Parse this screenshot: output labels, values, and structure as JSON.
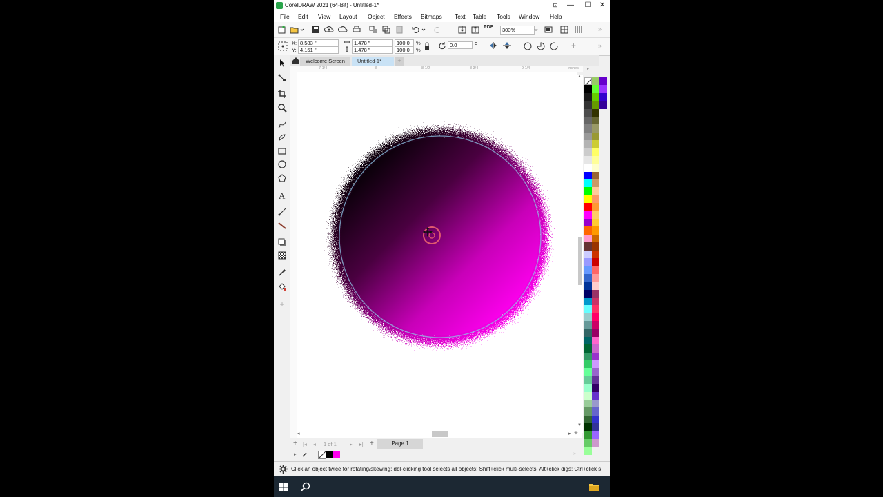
{
  "window": {
    "title": "CorelDRAW 2021 (64-Bit) - Untitled-1*"
  },
  "menu": [
    "File",
    "Edit",
    "View",
    "Layout",
    "Object",
    "Effects",
    "Bitmaps",
    "Text",
    "Table",
    "Tools",
    "Window",
    "Help"
  ],
  "toolbar": {
    "zoom": "303%",
    "pdf_label": "PDF"
  },
  "properties": {
    "x": "8.583 \"",
    "y": "4.151 \"",
    "width": "1.478 \"",
    "height": "1.478 \"",
    "scale_w": "100.0",
    "scale_h": "100.0",
    "percent": "%",
    "angle": "0.0",
    "x_label": "X:",
    "y_label": "Y:",
    "degree": "o"
  },
  "tabs": {
    "welcome": "Welcome Screen",
    "doc": "Untitled-1*"
  },
  "ruler": {
    "units": "inches",
    "ticks": [
      "7 1/4",
      "8",
      "8 1/2",
      "8 3/4",
      "9 1/4"
    ]
  },
  "page_nav": {
    "counter": "1 of 1",
    "page_tab": "Page 1"
  },
  "status": {
    "hint": "Click an object twice for rotating/skewing; dbl-clicking tool selects all objects; Shift+click multi-selects; Alt+click digs; Ctrl+click s"
  },
  "colors": {
    "accent": "#ff00ee",
    "dark": "#1a0014",
    "selection": "#c8e4f4"
  },
  "palette_col1": [
    "#000000",
    "#1a1a1a",
    "#333333",
    "#4d4d4d",
    "#666666",
    "#808080",
    "#999999",
    "#b3b3b3",
    "#cccccc",
    "#e6e6e6",
    "#ffffff",
    "#0000ff",
    "#00ffff",
    "#00ff00",
    "#ffff00",
    "#ff0000",
    "#ff00ff",
    "#9900cc",
    "#ff6600",
    "#ff99cc",
    "#663333",
    "#ccccff",
    "#9999ff",
    "#6699ff",
    "#3366cc",
    "#003399",
    "#000066",
    "#0099cc",
    "#66ffff",
    "#99cccc",
    "#669999",
    "#336666",
    "#006666",
    "#006633",
    "#339966",
    "#33cc66",
    "#66ff99",
    "#66cc99",
    "#99ffcc",
    "#ccffcc",
    "#99cc99",
    "#669966",
    "#336633",
    "#003300",
    "#339933",
    "#66cc66",
    "#99ff99"
  ],
  "palette_col2": [
    "#99cc66",
    "#66ff33",
    "#66cc00",
    "#669900",
    "#333300",
    "#666633",
    "#999966",
    "#999933",
    "#cccc33",
    "#ffff66",
    "#ffff99",
    "#ffffcc",
    "#996633",
    "#cc9966",
    "#ffcc99",
    "#ff9966",
    "#ff9933",
    "#ffcc66",
    "#ffcc33",
    "#ff9900",
    "#cc6600",
    "#993300",
    "#cc3300",
    "#cc0000",
    "#ff6666",
    "#ff9999",
    "#ffcccc",
    "#993366",
    "#cc3366",
    "#ff3366",
    "#ff0066",
    "#cc0066",
    "#990066",
    "#ff66cc",
    "#cc66cc",
    "#9933cc",
    "#cc99ff",
    "#9966cc",
    "#663399",
    "#330066",
    "#6633cc",
    "#9999cc",
    "#6666cc",
    "#3333cc",
    "#333399",
    "#9966ff",
    "#cc99cc"
  ],
  "palette_col3": [
    "#6600cc",
    "#9933ff",
    "#3300cc",
    "#330099"
  ],
  "fill_colors": [
    "#000000",
    "#ff00ee"
  ]
}
